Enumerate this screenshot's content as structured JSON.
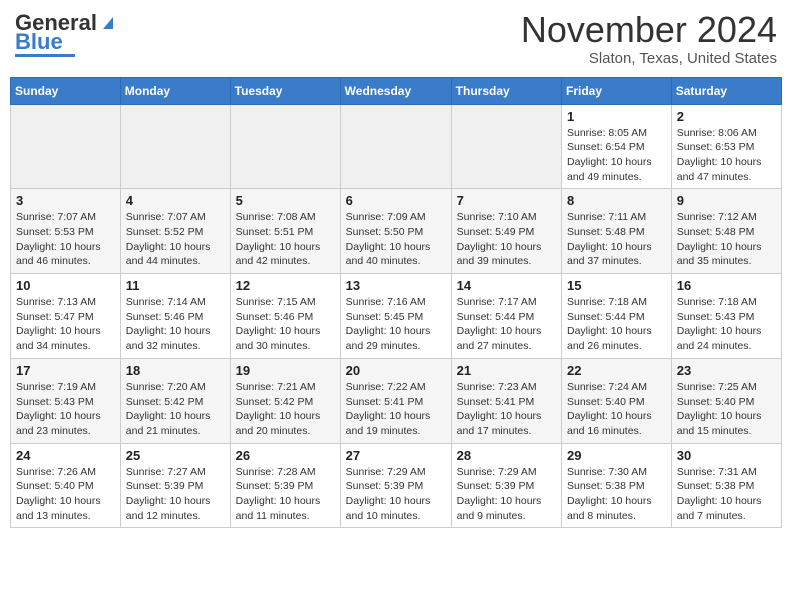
{
  "header": {
    "logo_line1": "General",
    "logo_line2": "Blue",
    "month_title": "November 2024",
    "location": "Slaton, Texas, United States"
  },
  "days_of_week": [
    "Sunday",
    "Monday",
    "Tuesday",
    "Wednesday",
    "Thursday",
    "Friday",
    "Saturday"
  ],
  "weeks": [
    [
      {
        "day": "",
        "info": ""
      },
      {
        "day": "",
        "info": ""
      },
      {
        "day": "",
        "info": ""
      },
      {
        "day": "",
        "info": ""
      },
      {
        "day": "",
        "info": ""
      },
      {
        "day": "1",
        "info": "Sunrise: 8:05 AM\nSunset: 6:54 PM\nDaylight: 10 hours\nand 49 minutes."
      },
      {
        "day": "2",
        "info": "Sunrise: 8:06 AM\nSunset: 6:53 PM\nDaylight: 10 hours\nand 47 minutes."
      }
    ],
    [
      {
        "day": "3",
        "info": "Sunrise: 7:07 AM\nSunset: 5:53 PM\nDaylight: 10 hours\nand 46 minutes."
      },
      {
        "day": "4",
        "info": "Sunrise: 7:07 AM\nSunset: 5:52 PM\nDaylight: 10 hours\nand 44 minutes."
      },
      {
        "day": "5",
        "info": "Sunrise: 7:08 AM\nSunset: 5:51 PM\nDaylight: 10 hours\nand 42 minutes."
      },
      {
        "day": "6",
        "info": "Sunrise: 7:09 AM\nSunset: 5:50 PM\nDaylight: 10 hours\nand 40 minutes."
      },
      {
        "day": "7",
        "info": "Sunrise: 7:10 AM\nSunset: 5:49 PM\nDaylight: 10 hours\nand 39 minutes."
      },
      {
        "day": "8",
        "info": "Sunrise: 7:11 AM\nSunset: 5:48 PM\nDaylight: 10 hours\nand 37 minutes."
      },
      {
        "day": "9",
        "info": "Sunrise: 7:12 AM\nSunset: 5:48 PM\nDaylight: 10 hours\nand 35 minutes."
      }
    ],
    [
      {
        "day": "10",
        "info": "Sunrise: 7:13 AM\nSunset: 5:47 PM\nDaylight: 10 hours\nand 34 minutes."
      },
      {
        "day": "11",
        "info": "Sunrise: 7:14 AM\nSunset: 5:46 PM\nDaylight: 10 hours\nand 32 minutes."
      },
      {
        "day": "12",
        "info": "Sunrise: 7:15 AM\nSunset: 5:46 PM\nDaylight: 10 hours\nand 30 minutes."
      },
      {
        "day": "13",
        "info": "Sunrise: 7:16 AM\nSunset: 5:45 PM\nDaylight: 10 hours\nand 29 minutes."
      },
      {
        "day": "14",
        "info": "Sunrise: 7:17 AM\nSunset: 5:44 PM\nDaylight: 10 hours\nand 27 minutes."
      },
      {
        "day": "15",
        "info": "Sunrise: 7:18 AM\nSunset: 5:44 PM\nDaylight: 10 hours\nand 26 minutes."
      },
      {
        "day": "16",
        "info": "Sunrise: 7:18 AM\nSunset: 5:43 PM\nDaylight: 10 hours\nand 24 minutes."
      }
    ],
    [
      {
        "day": "17",
        "info": "Sunrise: 7:19 AM\nSunset: 5:43 PM\nDaylight: 10 hours\nand 23 minutes."
      },
      {
        "day": "18",
        "info": "Sunrise: 7:20 AM\nSunset: 5:42 PM\nDaylight: 10 hours\nand 21 minutes."
      },
      {
        "day": "19",
        "info": "Sunrise: 7:21 AM\nSunset: 5:42 PM\nDaylight: 10 hours\nand 20 minutes."
      },
      {
        "day": "20",
        "info": "Sunrise: 7:22 AM\nSunset: 5:41 PM\nDaylight: 10 hours\nand 19 minutes."
      },
      {
        "day": "21",
        "info": "Sunrise: 7:23 AM\nSunset: 5:41 PM\nDaylight: 10 hours\nand 17 minutes."
      },
      {
        "day": "22",
        "info": "Sunrise: 7:24 AM\nSunset: 5:40 PM\nDaylight: 10 hours\nand 16 minutes."
      },
      {
        "day": "23",
        "info": "Sunrise: 7:25 AM\nSunset: 5:40 PM\nDaylight: 10 hours\nand 15 minutes."
      }
    ],
    [
      {
        "day": "24",
        "info": "Sunrise: 7:26 AM\nSunset: 5:40 PM\nDaylight: 10 hours\nand 13 minutes."
      },
      {
        "day": "25",
        "info": "Sunrise: 7:27 AM\nSunset: 5:39 PM\nDaylight: 10 hours\nand 12 minutes."
      },
      {
        "day": "26",
        "info": "Sunrise: 7:28 AM\nSunset: 5:39 PM\nDaylight: 10 hours\nand 11 minutes."
      },
      {
        "day": "27",
        "info": "Sunrise: 7:29 AM\nSunset: 5:39 PM\nDaylight: 10 hours\nand 10 minutes."
      },
      {
        "day": "28",
        "info": "Sunrise: 7:29 AM\nSunset: 5:39 PM\nDaylight: 10 hours\nand 9 minutes."
      },
      {
        "day": "29",
        "info": "Sunrise: 7:30 AM\nSunset: 5:38 PM\nDaylight: 10 hours\nand 8 minutes."
      },
      {
        "day": "30",
        "info": "Sunrise: 7:31 AM\nSunset: 5:38 PM\nDaylight: 10 hours\nand 7 minutes."
      }
    ]
  ]
}
